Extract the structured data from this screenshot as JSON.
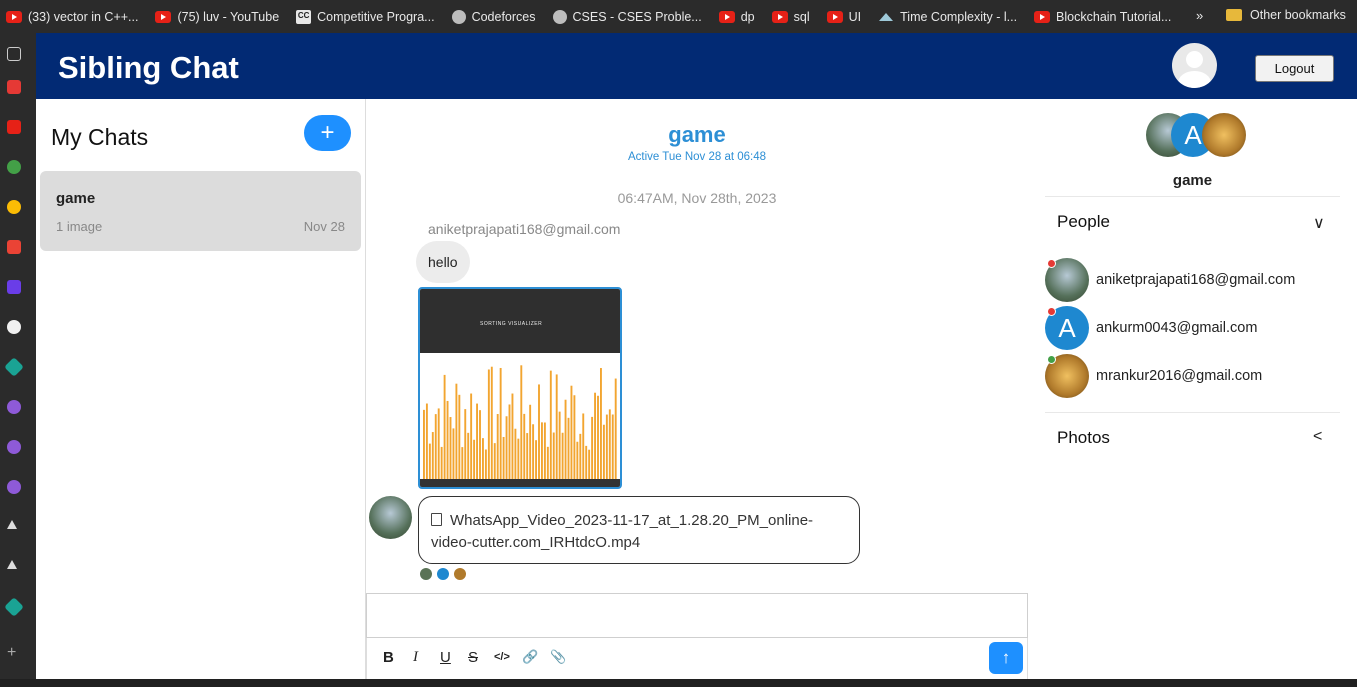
{
  "bookmarks": {
    "items": [
      {
        "label": "(33) vector in C++...",
        "icon": "youtube-icon"
      },
      {
        "label": "(75) luv - YouTube",
        "icon": "youtube-icon"
      },
      {
        "label": "Competitive Progra...",
        "icon": "cc-icon"
      },
      {
        "label": "Codeforces",
        "icon": "globe-icon"
      },
      {
        "label": "CSES - CSES Proble...",
        "icon": "globe-icon"
      },
      {
        "label": "dp",
        "icon": "youtube-icon"
      },
      {
        "label": "sql",
        "icon": "youtube-icon"
      },
      {
        "label": "UI",
        "icon": "youtube-icon"
      },
      {
        "label": "Time Complexity - l...",
        "icon": "mountain-icon"
      },
      {
        "label": "Blockchain Tutorial...",
        "icon": "youtube-icon"
      }
    ],
    "more": "»",
    "other": "Other bookmarks",
    "cc_glyph": "CC"
  },
  "app": {
    "brand": "Sibling Chat",
    "logout_label": "Logout"
  },
  "chats": {
    "title": "My Chats",
    "add_glyph": "+",
    "items": [
      {
        "name": "game",
        "preview": "1 image",
        "date": "Nov 28"
      }
    ]
  },
  "conversation": {
    "title": "game",
    "status": "Active Tue Nov 28 at 06:48",
    "date_separator": "06:47AM, Nov 28th, 2023",
    "sender": "aniketprajapati168@gmail.com",
    "text_message": "hello",
    "image_caption": "SORTING VISUALIZER",
    "file_name": "WhatsApp_Video_2023-11-17_at_1.28.20_PM_online-video-cutter.com_IRHtdcO.mp4"
  },
  "composer": {
    "placeholder": "",
    "format_buttons": [
      "B",
      "I",
      "U",
      "S",
      "</>",
      "🔗",
      "📎"
    ],
    "send_glyph": "↑"
  },
  "details": {
    "name": "game",
    "people_label": "People",
    "people_chevron": "∨",
    "photos_label": "Photos",
    "photos_chevron": "<",
    "people": [
      {
        "email": "aniketprajapati168@gmail.com",
        "status_color": "#e53935"
      },
      {
        "email": "ankurm0043@gmail.com",
        "status_color": "#e53935",
        "initial": "A"
      },
      {
        "email": "mrankur2016@gmail.com",
        "status_color": "#43a047"
      }
    ]
  },
  "colors": {
    "header": "#022a74",
    "accent": "#1e90ff",
    "title_blue": "#2d8fd5"
  }
}
